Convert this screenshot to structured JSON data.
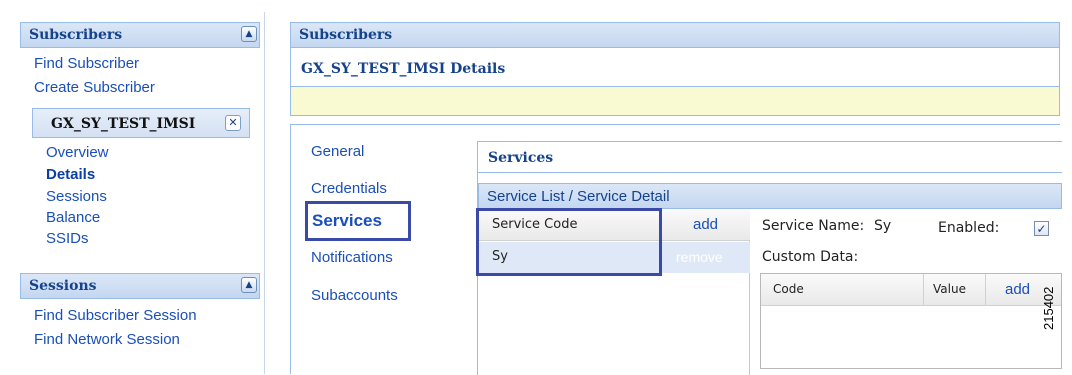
{
  "left": {
    "subscribers_panel": {
      "title": "Subscribers",
      "toggle_icon": "▲"
    },
    "links": [
      "Find Subscriber",
      "Create Subscriber"
    ],
    "subscriber_tab": {
      "label": "GX_SY_TEST_IMSI",
      "close_icon": "✕"
    },
    "sub_nav": [
      {
        "label": "Overview",
        "active": false
      },
      {
        "label": "Details",
        "active": true
      },
      {
        "label": "Sessions",
        "active": false
      },
      {
        "label": "Balance",
        "active": false
      },
      {
        "label": "SSIDs",
        "active": false
      }
    ],
    "sessions_panel": {
      "title": "Sessions",
      "toggle_icon": "▲"
    },
    "session_links": [
      "Find Subscriber Session",
      "Find Network Session"
    ]
  },
  "main": {
    "panel_title": "Subscribers",
    "details_title": "GX_SY_TEST_IMSI Details",
    "vtabs": [
      {
        "label": "General",
        "active": false
      },
      {
        "label": "Credentials",
        "active": false
      },
      {
        "label": "Services",
        "active": true
      },
      {
        "label": "Notifications",
        "active": false
      },
      {
        "label": "Subaccounts",
        "active": false
      }
    ],
    "services": {
      "header": "Services",
      "section_title": "Service List / Service Detail",
      "service_code_header": "Service Code",
      "add_label": "add",
      "remove_label": "remove",
      "rows": [
        "Sy"
      ],
      "service_name_label": "Service Name:",
      "service_name_value": "Sy",
      "enabled_label": "Enabled:",
      "enabled_checked": true,
      "custom_data_label": "Custom Data:",
      "custom_cols": {
        "code": "Code",
        "value": "Value",
        "add": "add"
      }
    }
  },
  "side_id": "215402",
  "colors": {
    "accent": "#15428b",
    "header_bg": "#c4d7f0",
    "border": "#99bbe8",
    "highlight_box": "#3a4aa8",
    "yellow_bar": "#fafad2"
  }
}
